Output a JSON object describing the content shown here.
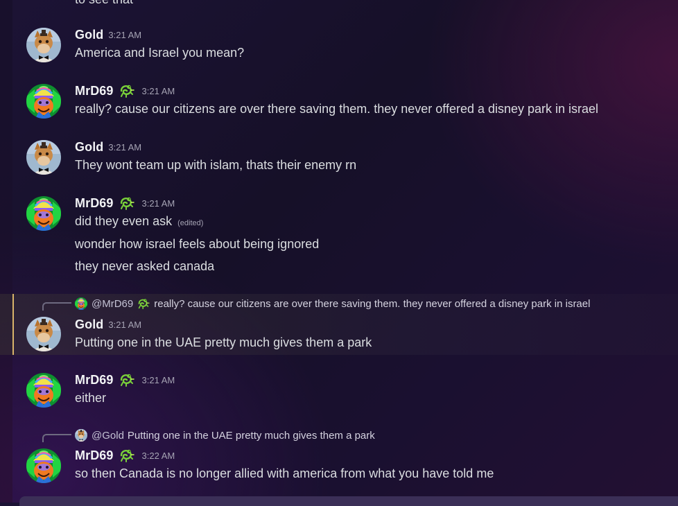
{
  "top_fragment": "to see that",
  "users": {
    "gold": "Gold",
    "mrd69": "MrD69"
  },
  "icons": {
    "gold_avatar": "fox-animatronic-avatar",
    "mrd69_avatar": "rainbow-cap-orange-character-avatar",
    "mrd69_badge": "green-gecko-badge-icon"
  },
  "colors": {
    "mention_bar": "#d9b46a",
    "badge_green": "#7ad13a"
  },
  "messages": [
    {
      "author": "Gold",
      "time": "3:21 AM",
      "lines": [
        "America and Israel you mean?"
      ]
    },
    {
      "author": "MrD69",
      "time": "3:21 AM",
      "lines": [
        "really? cause our citizens are over there saving them. they never offered a disney park in israel"
      ]
    },
    {
      "author": "Gold",
      "time": "3:21 AM",
      "lines": [
        "They wont team up with islam, thats their enemy rn"
      ]
    },
    {
      "author": "MrD69",
      "time": "3:21 AM",
      "lines": [
        "did they even ask",
        "wonder how israel feels about being ignored",
        "they never asked canada"
      ],
      "edited": "(edited)"
    },
    {
      "author": "Gold",
      "time": "3:21 AM",
      "reply_to": "@MrD69",
      "reply_text": "really? cause our citizens are over there saving them. they never offered a disney park in israel",
      "lines": [
        "Putting one in the UAE pretty much gives them a park"
      ]
    },
    {
      "author": "MrD69",
      "time": "3:21 AM",
      "lines": [
        "either"
      ]
    },
    {
      "author": "MrD69",
      "time": "3:22 AM",
      "reply_to": "@Gold",
      "reply_text": "Putting one in the UAE pretty much gives them a park",
      "lines": [
        "so then Canada is no longer allied with america from what you have told me"
      ]
    }
  ]
}
